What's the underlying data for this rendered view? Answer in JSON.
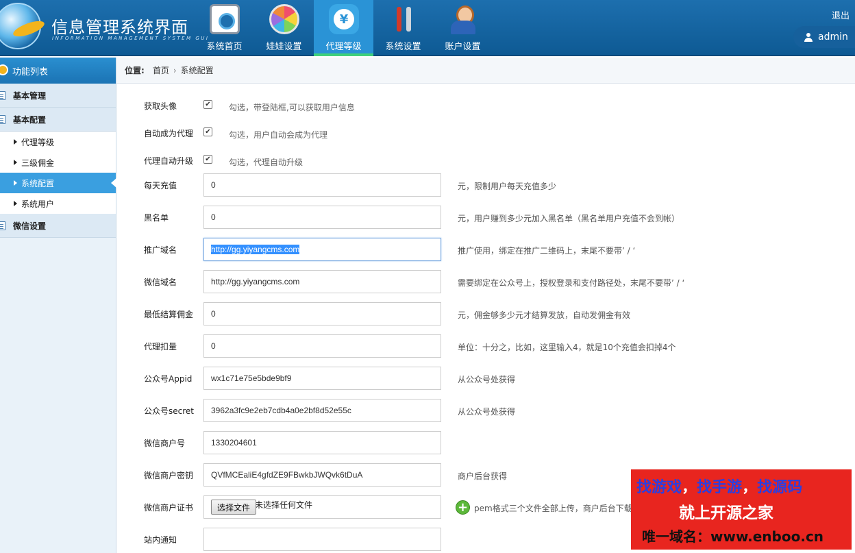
{
  "app": {
    "title": "信息管理系统界面",
    "subtitle": "INFORMATION MANAGEMENT SYSTEM GUI"
  },
  "nav": [
    {
      "label": "系统首页",
      "icon": "home-icon"
    },
    {
      "label": "娃娃设置",
      "icon": "color-wheel-icon"
    },
    {
      "label": "代理等级",
      "icon": "yen-cloud-icon",
      "active": true
    },
    {
      "label": "系统设置",
      "icon": "tools-icon"
    },
    {
      "label": "账户设置",
      "icon": "user-account-icon"
    }
  ],
  "header": {
    "logout": "退出",
    "admin": "admin"
  },
  "sidebar": {
    "title": "功能列表",
    "groups": [
      {
        "label": "基本管理"
      },
      {
        "label": "基本配置"
      },
      {
        "label": "微信设置"
      }
    ],
    "subitems": [
      {
        "label": "代理等级"
      },
      {
        "label": "三级佣金"
      },
      {
        "label": "系统配置",
        "active": true
      },
      {
        "label": "系统用户"
      }
    ]
  },
  "breadcrumb": {
    "prefix": "位置:",
    "home": "首页",
    "separator": "›",
    "current": "系统配置"
  },
  "form": {
    "checkboxes": [
      {
        "label": "获取头像",
        "checked": true,
        "hint": "勾选，带登陆框,可以获取用户信息"
      },
      {
        "label": "自动成为代理",
        "checked": true,
        "hint": "勾选，用户自动会成为代理"
      },
      {
        "label": "代理自动升级",
        "checked": true,
        "hint": "勾选，代理自动升级"
      }
    ],
    "fields": [
      {
        "label": "每天充值",
        "value": "0",
        "hint": "元，限制用户每天充值多少"
      },
      {
        "label": "黑名单",
        "value": "0",
        "hint": "元，用户赚到多少元加入黑名单（黑名单用户充值不会到帐）"
      },
      {
        "label": "推广域名",
        "value": "http://gg.yiyangcms.com",
        "hint": "推广使用，绑定在推广二维码上，末尾不要带’ / ‘"
      },
      {
        "label": "微信域名",
        "value": "http://gg.yiyangcms.com",
        "hint": "需要绑定在公众号上，授权登录和支付路径处，末尾不要带’ / ‘"
      },
      {
        "label": "最低结算佣金",
        "value": "0",
        "hint": "元，佣金够多少元才结算发放，自动发佣金有效"
      },
      {
        "label": "代理扣量",
        "value": "0",
        "hint": "单位：十分之，比如，这里输入4，就是10个充值会扣掉4个"
      },
      {
        "label": "公众号Appid",
        "value": "wx1c71e75e5bde9bf9",
        "hint": "从公众号处获得"
      },
      {
        "label": "公众号secret",
        "value": "3962a3fc9e2eb7cdb4a0e2bf8d52e55c",
        "hint": "从公众号处获得"
      },
      {
        "label": "微信商户号",
        "value": "1330204601",
        "hint": ""
      },
      {
        "label": "微信商户密钥",
        "value": "QVfMCEaliE4gfdZE9FBwkbJWQvk6tDuA",
        "hint": "商户后台获得"
      }
    ],
    "file": {
      "label": "微信商户证书",
      "button": "选择文件",
      "status": "未选择任何文件",
      "hint": "pem格式三个文件全部上传，商户后台下载"
    },
    "notice": {
      "label": "站内通知",
      "value": ""
    }
  },
  "banner": {
    "line1_a": "找游戏",
    "line1_sep1": "，",
    "line1_b": "找手游",
    "line1_sep2": "，",
    "line1_c": "找源码",
    "line2": "就上开源之家",
    "line3": "唯一域名：www.enboo.cn"
  },
  "colors": {
    "header": "#1d6fae",
    "nav_active": "#2a93d6",
    "sidebar_active": "#3a9fe0",
    "banner": "#e8251f"
  }
}
